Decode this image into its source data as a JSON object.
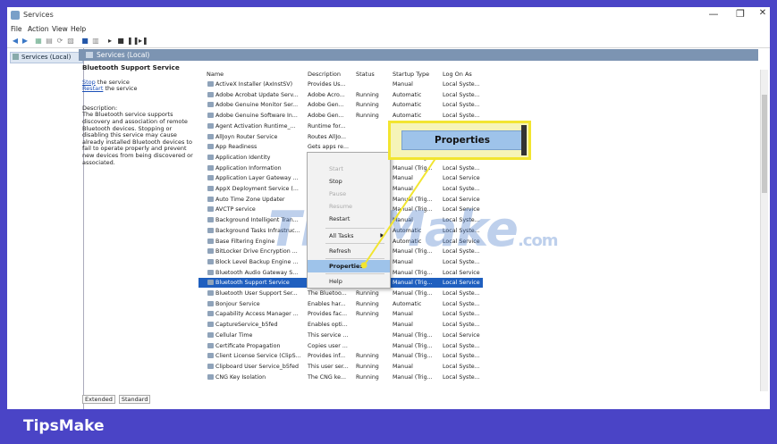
{
  "window": {
    "title": "Services",
    "minimize": "—",
    "maximize": "❐",
    "close": "✕"
  },
  "menu": [
    "File",
    "Action",
    "View",
    "Help"
  ],
  "toolbar_icons": [
    "back-icon",
    "forward-icon",
    "view-icon",
    "properties-icon",
    "refresh-icon",
    "export-icon",
    "help-icon",
    "console-icon",
    "play-icon",
    "stop-icon",
    "pause-icon",
    "restart-icon"
  ],
  "tree": {
    "root_label": "Services (Local)"
  },
  "header": {
    "title": "Services (Local)"
  },
  "detail": {
    "service_name": "Bluetooth Support Service",
    "stop_link": "Stop",
    "stop_suffix": " the service",
    "restart_link": "Restart",
    "restart_suffix": " the service",
    "description_label": "Description:",
    "description_text": "The Bluetooth service supports discovery and association of remote Bluetooth devices. Stopping or disabling this service may cause already installed Bluetooth devices to fail to operate properly and prevent new devices from being discovered or associated."
  },
  "table": {
    "columns": [
      "Name",
      "Description",
      "Status",
      "Startup Type",
      "Log On As"
    ],
    "rows": [
      [
        "ActiveX Installer (AxInstSV)",
        "Provides Us...",
        "",
        "Manual",
        "Local Syste..."
      ],
      [
        "Adobe Acrobat Update Serv...",
        "Adobe Acro...",
        "Running",
        "Automatic",
        "Local Syste..."
      ],
      [
        "Adobe Genuine Monitor Ser...",
        "Adobe Gen...",
        "Running",
        "Automatic",
        "Local Syste..."
      ],
      [
        "Adobe Genuine Software In...",
        "Adobe Gen...",
        "Running",
        "Automatic",
        "Local Syste..."
      ],
      [
        "Agent Activation Runtime_...",
        "Runtime for...",
        "",
        "",
        ""
      ],
      [
        "AllJoyn Router Service",
        "Routes AllJo...",
        "",
        "",
        ""
      ],
      [
        "App Readiness",
        "Gets apps re...",
        "",
        "",
        ""
      ],
      [
        "Application Identity",
        "",
        "",
        "Manual (Trig...",
        "Local Service"
      ],
      [
        "Application Information",
        "",
        "",
        "Manual (Trig...",
        "Local Syste..."
      ],
      [
        "Application Layer Gateway ...",
        "",
        "",
        "Manual",
        "Local Service"
      ],
      [
        "AppX Deployment Service (...",
        "",
        "",
        "Manual",
        "Local Syste..."
      ],
      [
        "Auto Time Zone Updater",
        "",
        "",
        "Manual (Trig...",
        "Local Service"
      ],
      [
        "AVCTP service",
        "",
        "",
        "Manual (Trig...",
        "Local Service"
      ],
      [
        "Background Intelligent Tran...",
        "",
        "",
        "Manual",
        "Local Syste..."
      ],
      [
        "Background Tasks Infrastruc...",
        "",
        "",
        "Automatic",
        "Local Syste..."
      ],
      [
        "Base Filtering Engine",
        "",
        "",
        "Automatic",
        "Local Service"
      ],
      [
        "BitLocker Drive Encryption ...",
        "",
        "",
        "Manual (Trig...",
        "Local Syste..."
      ],
      [
        "Block Level Backup Engine ...",
        "",
        "",
        "Manual",
        "Local Syste..."
      ],
      [
        "Bluetooth Audio Gateway S...",
        "",
        "",
        "Manual (Trig...",
        "Local Service"
      ],
      [
        "Bluetooth Support Service",
        "",
        "",
        "Manual (Trig...",
        "Local Service"
      ],
      [
        "Bluetooth User Support Ser...",
        "The Bluetoo...",
        "Running",
        "Manual (Trig...",
        "Local Syste..."
      ],
      [
        "Bonjour Service",
        "Enables har...",
        "Running",
        "Automatic",
        "Local Syste..."
      ],
      [
        "Capability Access Manager ...",
        "Provides fac...",
        "Running",
        "Manual",
        "Local Syste..."
      ],
      [
        "CaptureService_b5fed",
        "Enables opti...",
        "",
        "Manual",
        "Local Syste..."
      ],
      [
        "Cellular Time",
        "This service ...",
        "",
        "Manual (Trig...",
        "Local Service"
      ],
      [
        "Certificate Propagation",
        "Copies user ...",
        "",
        "Manual (Trig...",
        "Local Syste..."
      ],
      [
        "Client License Service (ClipS...",
        "Provides inf...",
        "Running",
        "Manual (Trig...",
        "Local Syste..."
      ],
      [
        "Clipboard User Service_b5fed",
        "This user ser...",
        "Running",
        "Manual",
        "Local Syste..."
      ],
      [
        "CNG Key Isolation",
        "The CNG ke...",
        "Running",
        "Manual (Trig...",
        "Local Syste..."
      ]
    ],
    "selected_index": 19
  },
  "context_menu": {
    "start": "Start",
    "stop": "Stop",
    "pause": "Pause",
    "resume": "Resume",
    "restart": "Restart",
    "all_tasks": "All Tasks",
    "refresh": "Refresh",
    "properties": "Properties",
    "help": "Help"
  },
  "callout": {
    "label": "Properties"
  },
  "tabs": [
    "Extended",
    "Standard"
  ],
  "watermark": {
    "main": "TipsMake",
    "suffix": ".com"
  },
  "footer": {
    "brand": "TipsMake"
  },
  "colors": {
    "frame": "#4a44c6",
    "selection": "#1f5fbf",
    "highlight": "#9ec3ea",
    "callout_border": "#f2e530"
  }
}
